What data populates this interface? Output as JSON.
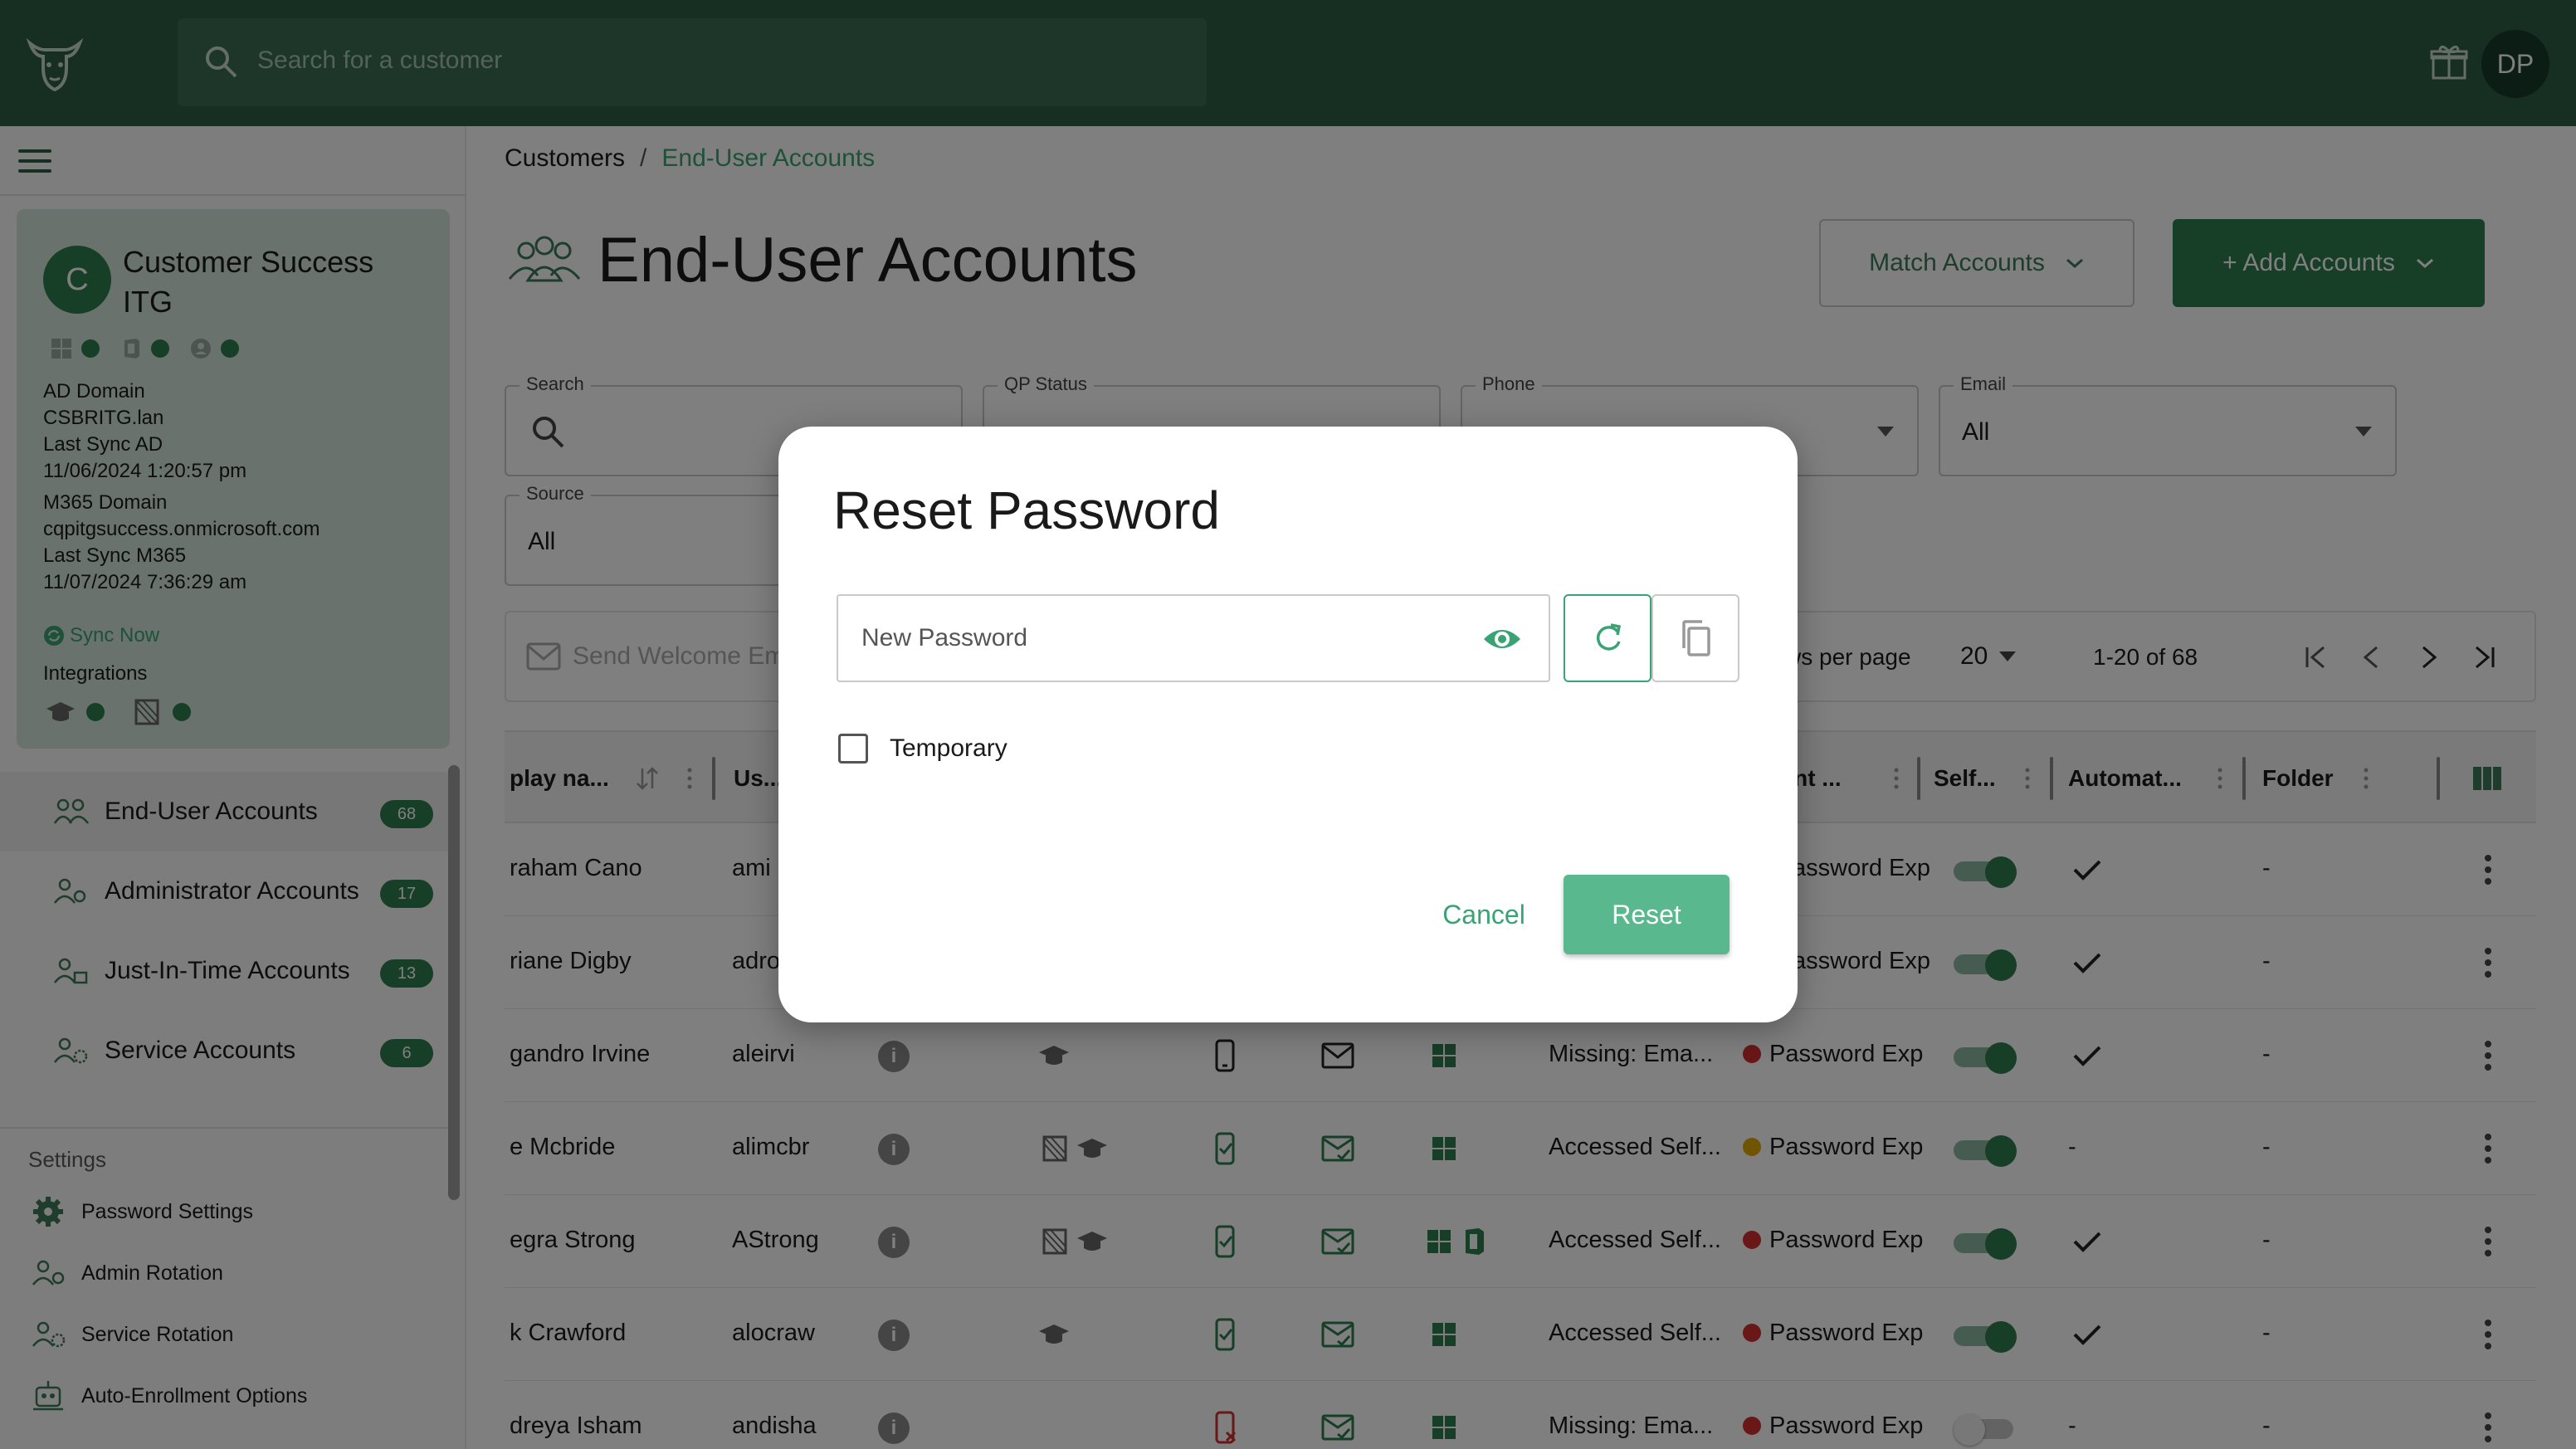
{
  "topbar": {
    "search_placeholder": "Search for a customer",
    "avatar_initials": "DP"
  },
  "customer": {
    "initial": "C",
    "name": "Customer Success ITG",
    "ad_domain_label": "AD Domain",
    "ad_domain": "CSBRITG.lan",
    "last_sync_ad_label": "Last Sync AD",
    "last_sync_ad": "11/06/2024 1:20:57 pm",
    "m365_domain_label": "M365 Domain",
    "m365_domain": "cqpitgsuccess.onmicrosoft.com",
    "last_sync_m365_label": "Last Sync M365",
    "last_sync_m365": "11/07/2024 7:36:29 am",
    "sync_now": "Sync Now",
    "integrations_label": "Integrations"
  },
  "nav": [
    {
      "label": "End-User Accounts",
      "count": "68"
    },
    {
      "label": "Administrator Accounts",
      "count": "17"
    },
    {
      "label": "Just-In-Time Accounts",
      "count": "13"
    },
    {
      "label": "Service Accounts",
      "count": "6"
    }
  ],
  "settings": {
    "heading": "Settings",
    "items": [
      "Password Settings",
      "Admin Rotation",
      "Service Rotation",
      "Auto-Enrollment Options"
    ]
  },
  "breadcrumb": {
    "root": "Customers",
    "current": "End-User Accounts"
  },
  "page": {
    "title": "End-User Accounts",
    "match_accounts": "Match Accounts",
    "add_accounts": "+ Add Accounts"
  },
  "filters": {
    "search_label": "Search",
    "qp_status_label": "QP Status",
    "phone_label": "Phone",
    "email_label": "Email",
    "email_value": "All",
    "source_label": "Source",
    "source_value": "All"
  },
  "toolbar": {
    "send_welcome": "Send Welcome Em",
    "rows_per_page": "ws per page",
    "rows_value": "20",
    "range": "1-20 of 68"
  },
  "table": {
    "headers": {
      "display_name": "play na...",
      "username": "Us...",
      "account": "unt ...",
      "self": "Self...",
      "automat": "Automat...",
      "folder": "Folder"
    },
    "rows": [
      {
        "name": "raham Cano",
        "user": "ami",
        "state": "",
        "status": "assword Exp",
        "dot": "",
        "automat": "check",
        "folder": "-",
        "toggle": true
      },
      {
        "name": "riane Digby",
        "user": "adro",
        "state": "",
        "status": "assword Exp",
        "dot": "",
        "automat": "check",
        "folder": "-",
        "toggle": true
      },
      {
        "name": "gandro Irvine",
        "user": "aleirvi",
        "state": "Missing: Ema...",
        "status": "Password Exp",
        "dot": "#d32f2f",
        "automat": "check",
        "folder": "-",
        "toggle": true
      },
      {
        "name": "e Mcbride",
        "user": "alimcbr",
        "state": "Accessed Self...",
        "status": "Password Exp",
        "dot": "#e0a800",
        "automat": "-",
        "folder": "-",
        "toggle": true
      },
      {
        "name": "egra Strong",
        "user": "AStrong",
        "state": "Accessed Self...",
        "status": "Password Exp",
        "dot": "#d32f2f",
        "automat": "check",
        "folder": "-",
        "toggle": true
      },
      {
        "name": "k Crawford",
        "user": "alocraw",
        "state": "Accessed Self...",
        "status": "Password Exp",
        "dot": "#d32f2f",
        "automat": "check",
        "folder": "-",
        "toggle": true
      },
      {
        "name": "dreya Isham",
        "user": "andisha",
        "state": "Missing: Ema...",
        "status": "Password Exp",
        "dot": "#d32f2f",
        "automat": "-",
        "folder": "-",
        "toggle": false
      }
    ]
  },
  "modal": {
    "title": "Reset Password",
    "new_password_placeholder": "New Password",
    "temporary_label": "Temporary",
    "cancel": "Cancel",
    "reset": "Reset"
  },
  "colors": {
    "brand": "#2e5e45",
    "accent": "#2e7d4f",
    "link": "#3aa374",
    "reset_button": "#5ab88e"
  }
}
